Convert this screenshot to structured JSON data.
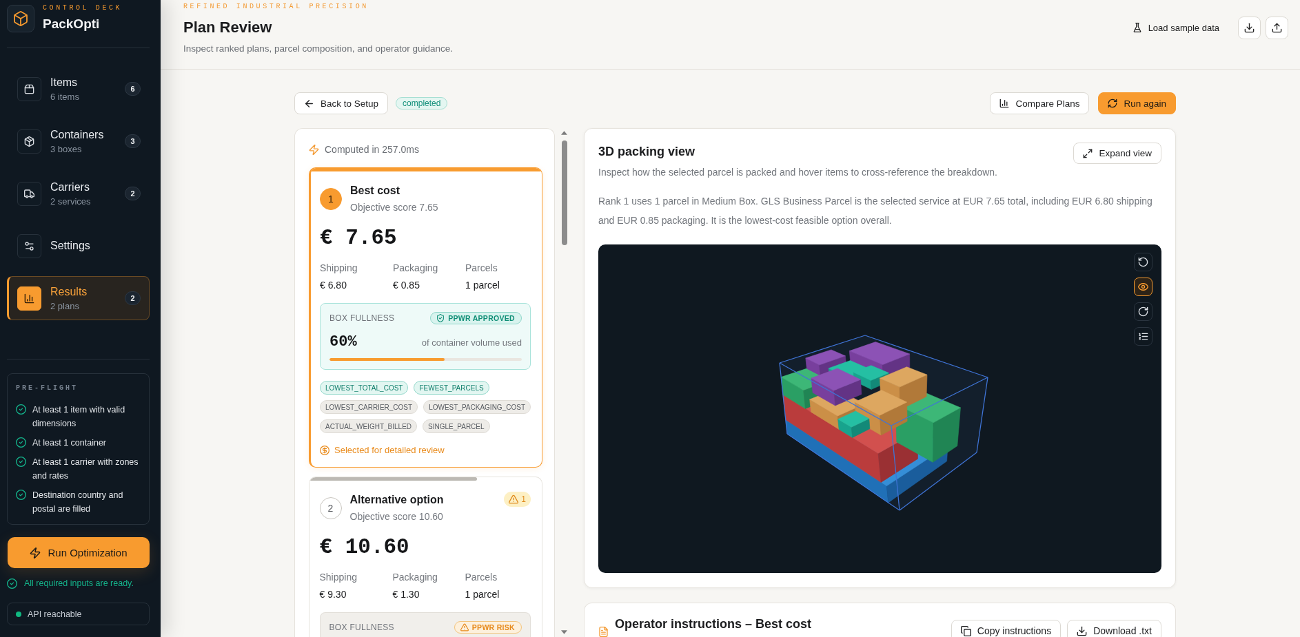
{
  "sidebar": {
    "eyebrow": "CONTROL DECK",
    "brand": "PackOpti",
    "nav": [
      {
        "kind": "items",
        "label": "Items",
        "subtitle": "6 items",
        "count": "6",
        "selected": false
      },
      {
        "kind": "containers",
        "label": "Containers",
        "subtitle": "3 boxes",
        "count": "3",
        "selected": false
      },
      {
        "kind": "carriers",
        "label": "Carriers",
        "subtitle": "2 services",
        "count": "2",
        "selected": false
      },
      {
        "kind": "settings",
        "label": "Settings",
        "selected": false
      },
      {
        "kind": "results",
        "label": "Results",
        "subtitle": "2 plans",
        "count": "2",
        "selected": true
      }
    ],
    "preflight": {
      "title": "PRE-FLIGHT",
      "checks": [
        {
          "text": "At least 1 item with valid dimensions",
          "passed": true
        },
        {
          "text": "At least 1 container",
          "passed": true
        },
        {
          "text": "At least 1 carrier with zones and rates",
          "passed": true
        },
        {
          "text": "Destination country and postal are filled",
          "passed": true
        }
      ]
    },
    "run_button": "Run Optimization",
    "ready_message": "All required inputs are ready.",
    "api_status": {
      "label": "API reachable",
      "color": "#10b981"
    }
  },
  "header": {
    "eyebrow": "REFINED INDUSTRIAL PRECISION",
    "title": "Plan Review",
    "subtitle": "Inspect ranked plans, parcel composition, and operator guidance.",
    "load_sample": "Load sample data"
  },
  "toolbar": {
    "back": "Back to Setup",
    "status": "completed",
    "compare": "Compare Plans",
    "run_again": "Run again"
  },
  "plans": {
    "computed": "Computed in 257.0ms",
    "items": [
      {
        "rank": "1",
        "title": "Best cost",
        "score": "Objective score 7.65",
        "price": "€ 7.65",
        "level": 1,
        "selected": true,
        "stats": [
          {
            "label": "Shipping",
            "value": "€ 6.80"
          },
          {
            "label": "Packaging",
            "value": "€ 0.85"
          },
          {
            "label": "Parcels",
            "value": "1 parcel"
          }
        ],
        "fullness": {
          "label": "BOX FULLNESS",
          "badge": {
            "text": "PPWR APPROVED",
            "kind": "approved"
          },
          "value": "60%",
          "caption": "of container volume used",
          "level": 0.6
        },
        "tags": [
          {
            "text": "LOWEST_TOTAL_COST",
            "highlighted": true
          },
          {
            "text": "FEWEST_PARCELS",
            "highlighted": true
          },
          {
            "text": "LOWEST_CARRIER_COST",
            "highlighted": false
          },
          {
            "text": "LOWEST_PACKAGING_COST",
            "highlighted": false
          },
          {
            "text": "ACTUAL_WEIGHT_BILLED",
            "highlighted": false
          },
          {
            "text": "SINGLE_PARCEL",
            "highlighted": false
          }
        ],
        "note": "Selected for detailed review"
      },
      {
        "rank": "2",
        "title": "Alternative option",
        "score": "Objective score 10.60",
        "warnings": "1",
        "price": "€ 10.60",
        "level": 0.72,
        "selected": false,
        "stats": [
          {
            "label": "Shipping",
            "value": "€ 9.30"
          },
          {
            "label": "Packaging",
            "value": "€ 1.30"
          },
          {
            "label": "Parcels",
            "value": "1 parcel"
          }
        ],
        "fullness": {
          "label": "BOX FULLNESS",
          "badge": {
            "text": "PPWR RISK",
            "kind": "risk"
          }
        }
      }
    ]
  },
  "viewer": {
    "title": "3D packing view",
    "subtitle": "Inspect how the selected parcel is packed and hover items to cross-reference the breakdown.",
    "summary": "Rank 1 uses 1 parcel in Medium Box. GLS Business Parcel is the selected service at EUR 7.65 total, including EUR 6.80 shipping and EUR 0.85 packaging. It is the lowest-cost feasible option overall.",
    "expand": "Expand view",
    "tools": [
      {
        "kind": "reset",
        "selected": false
      },
      {
        "kind": "view",
        "selected": true
      },
      {
        "kind": "rotate",
        "selected": false
      },
      {
        "kind": "list",
        "selected": false
      }
    ]
  },
  "instructions": {
    "title": "Operator instructions – Best cost",
    "copy": "Copy instructions",
    "download": "Download .txt"
  }
}
